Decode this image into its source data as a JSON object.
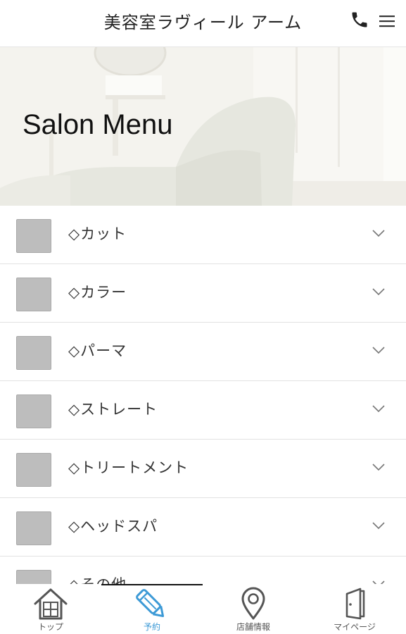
{
  "header": {
    "title": "美容室ラヴィール アーム",
    "phone_icon": "phone-icon",
    "menu_icon": "hamburger-menu-icon"
  },
  "hero": {
    "title": "Salon Menu"
  },
  "menu": {
    "items": [
      {
        "label": "◇カット"
      },
      {
        "label": "◇カラー"
      },
      {
        "label": "◇パーマ"
      },
      {
        "label": "◇ストレート"
      },
      {
        "label": "◇トリートメント"
      },
      {
        "label": "◇ヘッドスパ"
      },
      {
        "label": "◇その他"
      }
    ]
  },
  "bottom_nav": {
    "active_index": 1,
    "active_color": "#3d9ad6",
    "tabs": [
      {
        "label": "トップ",
        "icon": "home-icon"
      },
      {
        "label": "予約",
        "icon": "pencil-icon"
      },
      {
        "label": "店舗情報",
        "icon": "map-pin-icon"
      },
      {
        "label": "マイページ",
        "icon": "door-icon"
      }
    ]
  }
}
